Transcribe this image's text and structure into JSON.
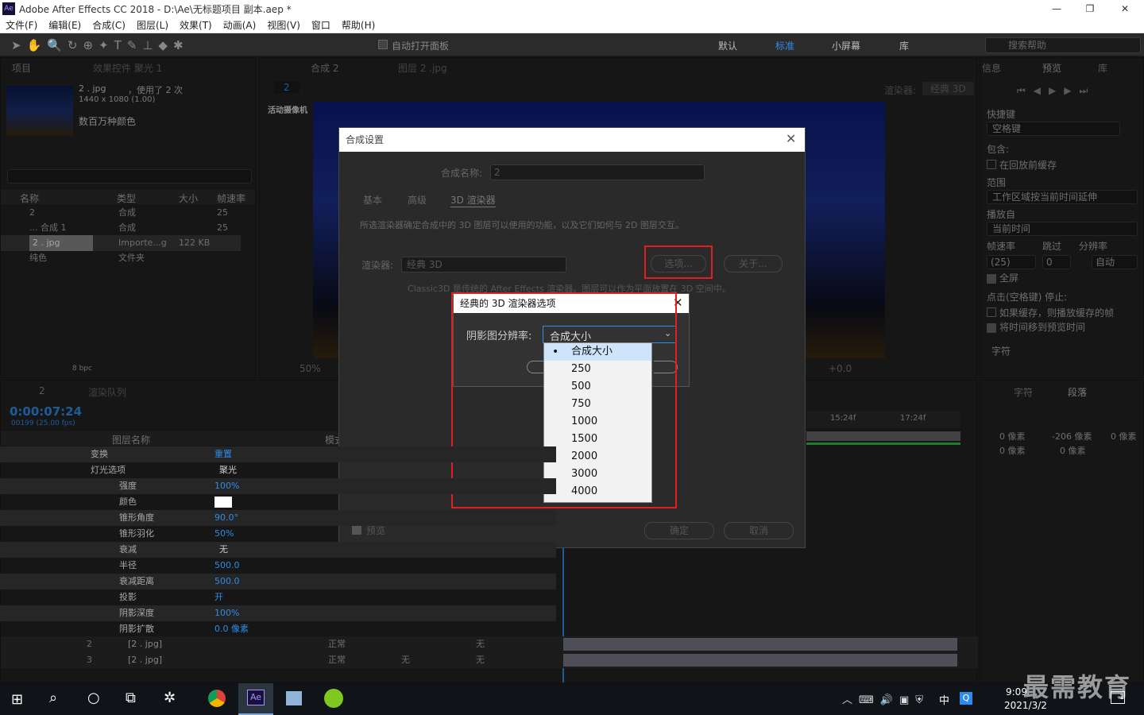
{
  "window": {
    "title": "Adobe After Effects CC 2018 - D:\\Ae\\无标题项目 副本.aep *",
    "app_icon": "Ae"
  },
  "menu": [
    "文件(F)",
    "编辑(E)",
    "合成(C)",
    "图层(L)",
    "效果(T)",
    "动画(A)",
    "视图(V)",
    "窗口",
    "帮助(H)"
  ],
  "toolbar": {
    "auto_open": "自动打开面板",
    "workspaces": [
      "默认",
      "标准",
      "小屏幕",
      "库"
    ],
    "search_placeholder": "搜索帮助"
  },
  "project": {
    "tab": "项目",
    "effects_tab": "效果控件 聚光 1",
    "item_name": "2 . jpg",
    "usage": "，使用了 2 次",
    "dimensions": "1440 x 1080 (1.00)",
    "colors": "数百万种颜色",
    "columns": [
      "名称",
      "类型",
      "大小",
      "帧速率"
    ],
    "items": [
      {
        "name": "2",
        "type": "合成",
        "size": "",
        "fps": "25"
      },
      {
        "name": "... 合成 1",
        "type": "合成",
        "size": "",
        "fps": "25"
      },
      {
        "name": "2 . jpg",
        "type": "Importe...g",
        "size": "122 KB",
        "fps": ""
      },
      {
        "name": "纯色",
        "type": "文件夹",
        "size": "",
        "fps": ""
      }
    ],
    "bpc": "8 bpc"
  },
  "viewer": {
    "tab_comp": "合成 2",
    "tab_layer": "图层 2 .jpg",
    "comp_label": "2",
    "renderer_label": "渲染器:",
    "renderer_value": "经典 3D",
    "camera": "活动摄像机",
    "zoom": "50%",
    "offset": "+0.0"
  },
  "preview": {
    "tab": "预览",
    "info": "信息",
    "lib": "库",
    "shortcut": "快捷键",
    "key": "空格键",
    "include": "包含:",
    "cache": "在回放前缓存",
    "range": "范围",
    "range_value": "工作区域按当前时间延伸",
    "play_from": "播放自",
    "play_value": "当前时间",
    "fps": "帧速率",
    "skip": "跳过",
    "res": "分辨率",
    "fps_value": "(25)",
    "skip_value": "0",
    "res_value": "自动",
    "fullscreen": "全屏",
    "stop_label": "点击(空格键) 停止:",
    "opt1": "如果缓存，则播放缓存的帧",
    "opt2": "将时间移到预览时间",
    "char": "字符",
    "para": "段落",
    "px1": "0 像素",
    "px2": "-206 像素",
    "px3": "0 像素",
    "px4": "0 像素",
    "px5": "0 像素"
  },
  "timeline": {
    "tab": "2",
    "render_tab": "渲染队列",
    "timecode": "0:00:07:24",
    "fps_note": "00199 (25.00 fps)",
    "col_name": "图层名称",
    "col_mode": "模式",
    "ruler": [
      "15:24f",
      "17:24f"
    ],
    "props": [
      {
        "name": "变换",
        "value": "重置"
      },
      {
        "name": "灯光选项",
        "value": "聚光"
      },
      {
        "name": "强度",
        "value": "100%"
      },
      {
        "name": "颜色",
        "value": ""
      },
      {
        "name": "锥形角度",
        "value": "90.0°"
      },
      {
        "name": "锥形羽化",
        "value": "50%"
      },
      {
        "name": "衰减",
        "value": "无"
      },
      {
        "name": "半径",
        "value": "500.0"
      },
      {
        "name": "衰减距离",
        "value": "500.0"
      },
      {
        "name": "投影",
        "value": "开"
      },
      {
        "name": "阴影深度",
        "value": "100%"
      },
      {
        "name": "阴影扩散",
        "value": "0.0 像素"
      }
    ],
    "layers": [
      {
        "num": "2",
        "name": "[2 . jpg]",
        "mode": "正常",
        "track": "",
        "parent": "无"
      },
      {
        "num": "3",
        "name": "[2 . jpg]",
        "mode": "正常",
        "track": "无",
        "parent": "无"
      }
    ]
  },
  "dialog": {
    "title": "合成设置",
    "name_label": "合成名称:",
    "name_value": "2",
    "tabs": [
      "基本",
      "高级",
      "3D 渲染器"
    ],
    "desc": "所选渲染器确定合成中的 3D 图层可以使用的功能，以及它们如何与 2D 图层交互。",
    "renderer_label": "渲染器:",
    "renderer_value": "经典 3D",
    "options_btn": "选项...",
    "about_btn": "关于...",
    "classic_desc": "Classic3D 是传统的 After Effects 渲染器。图层可以作为平面放置在 3D 空间中。",
    "preview": "预览",
    "ok": "确定",
    "cancel": "取消"
  },
  "subdialog": {
    "title": "经典的 3D 渲染器选项",
    "label": "阴影图分辨率:",
    "value": "合成大小",
    "options": [
      "合成大小",
      "250",
      "500",
      "750",
      "1000",
      "1500",
      "2000",
      "3000",
      "4000"
    ],
    "selected": "合成大小"
  },
  "taskbar": {
    "time": "9:09",
    "date": "2021/3/2",
    "ime": "中",
    "watermark": "最需教育",
    "notif": "1"
  },
  "colors": {
    "accent": "#2d8ceb",
    "highlight": "#e02020",
    "green": "#3cb84a"
  }
}
